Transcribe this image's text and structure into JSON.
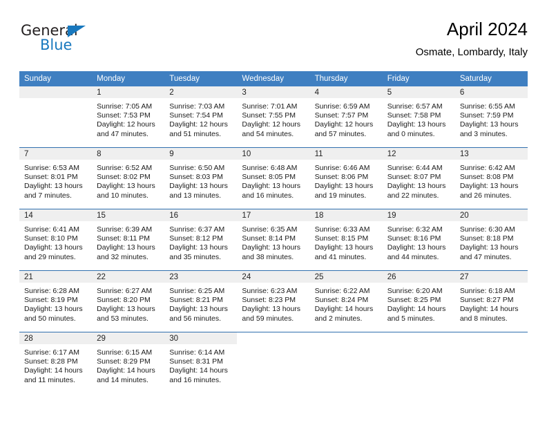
{
  "brand": {
    "name_top": "General",
    "name_bottom": "Blue",
    "triangle_color": "#1878be"
  },
  "header": {
    "title": "April 2024",
    "subtitle": "Osmate, Lombardy, Italy"
  },
  "theme": {
    "header_bar": "#3f7fc1",
    "row_divider": "#2f6fae",
    "daynum_band": "#efefef",
    "text": "#1a1a1a"
  },
  "weekday_headers": [
    "Sunday",
    "Monday",
    "Tuesday",
    "Wednesday",
    "Thursday",
    "Friday",
    "Saturday"
  ],
  "weeks": [
    [
      {
        "day": "",
        "lines": []
      },
      {
        "day": "1",
        "lines": [
          "Sunrise: 7:05 AM",
          "Sunset: 7:53 PM",
          "Daylight: 12 hours",
          "and 47 minutes."
        ]
      },
      {
        "day": "2",
        "lines": [
          "Sunrise: 7:03 AM",
          "Sunset: 7:54 PM",
          "Daylight: 12 hours",
          "and 51 minutes."
        ]
      },
      {
        "day": "3",
        "lines": [
          "Sunrise: 7:01 AM",
          "Sunset: 7:55 PM",
          "Daylight: 12 hours",
          "and 54 minutes."
        ]
      },
      {
        "day": "4",
        "lines": [
          "Sunrise: 6:59 AM",
          "Sunset: 7:57 PM",
          "Daylight: 12 hours",
          "and 57 minutes."
        ]
      },
      {
        "day": "5",
        "lines": [
          "Sunrise: 6:57 AM",
          "Sunset: 7:58 PM",
          "Daylight: 13 hours",
          "and 0 minutes."
        ]
      },
      {
        "day": "6",
        "lines": [
          "Sunrise: 6:55 AM",
          "Sunset: 7:59 PM",
          "Daylight: 13 hours",
          "and 3 minutes."
        ]
      }
    ],
    [
      {
        "day": "7",
        "lines": [
          "Sunrise: 6:53 AM",
          "Sunset: 8:01 PM",
          "Daylight: 13 hours",
          "and 7 minutes."
        ]
      },
      {
        "day": "8",
        "lines": [
          "Sunrise: 6:52 AM",
          "Sunset: 8:02 PM",
          "Daylight: 13 hours",
          "and 10 minutes."
        ]
      },
      {
        "day": "9",
        "lines": [
          "Sunrise: 6:50 AM",
          "Sunset: 8:03 PM",
          "Daylight: 13 hours",
          "and 13 minutes."
        ]
      },
      {
        "day": "10",
        "lines": [
          "Sunrise: 6:48 AM",
          "Sunset: 8:05 PM",
          "Daylight: 13 hours",
          "and 16 minutes."
        ]
      },
      {
        "day": "11",
        "lines": [
          "Sunrise: 6:46 AM",
          "Sunset: 8:06 PM",
          "Daylight: 13 hours",
          "and 19 minutes."
        ]
      },
      {
        "day": "12",
        "lines": [
          "Sunrise: 6:44 AM",
          "Sunset: 8:07 PM",
          "Daylight: 13 hours",
          "and 22 minutes."
        ]
      },
      {
        "day": "13",
        "lines": [
          "Sunrise: 6:42 AM",
          "Sunset: 8:08 PM",
          "Daylight: 13 hours",
          "and 26 minutes."
        ]
      }
    ],
    [
      {
        "day": "14",
        "lines": [
          "Sunrise: 6:41 AM",
          "Sunset: 8:10 PM",
          "Daylight: 13 hours",
          "and 29 minutes."
        ]
      },
      {
        "day": "15",
        "lines": [
          "Sunrise: 6:39 AM",
          "Sunset: 8:11 PM",
          "Daylight: 13 hours",
          "and 32 minutes."
        ]
      },
      {
        "day": "16",
        "lines": [
          "Sunrise: 6:37 AM",
          "Sunset: 8:12 PM",
          "Daylight: 13 hours",
          "and 35 minutes."
        ]
      },
      {
        "day": "17",
        "lines": [
          "Sunrise: 6:35 AM",
          "Sunset: 8:14 PM",
          "Daylight: 13 hours",
          "and 38 minutes."
        ]
      },
      {
        "day": "18",
        "lines": [
          "Sunrise: 6:33 AM",
          "Sunset: 8:15 PM",
          "Daylight: 13 hours",
          "and 41 minutes."
        ]
      },
      {
        "day": "19",
        "lines": [
          "Sunrise: 6:32 AM",
          "Sunset: 8:16 PM",
          "Daylight: 13 hours",
          "and 44 minutes."
        ]
      },
      {
        "day": "20",
        "lines": [
          "Sunrise: 6:30 AM",
          "Sunset: 8:18 PM",
          "Daylight: 13 hours",
          "and 47 minutes."
        ]
      }
    ],
    [
      {
        "day": "21",
        "lines": [
          "Sunrise: 6:28 AM",
          "Sunset: 8:19 PM",
          "Daylight: 13 hours",
          "and 50 minutes."
        ]
      },
      {
        "day": "22",
        "lines": [
          "Sunrise: 6:27 AM",
          "Sunset: 8:20 PM",
          "Daylight: 13 hours",
          "and 53 minutes."
        ]
      },
      {
        "day": "23",
        "lines": [
          "Sunrise: 6:25 AM",
          "Sunset: 8:21 PM",
          "Daylight: 13 hours",
          "and 56 minutes."
        ]
      },
      {
        "day": "24",
        "lines": [
          "Sunrise: 6:23 AM",
          "Sunset: 8:23 PM",
          "Daylight: 13 hours",
          "and 59 minutes."
        ]
      },
      {
        "day": "25",
        "lines": [
          "Sunrise: 6:22 AM",
          "Sunset: 8:24 PM",
          "Daylight: 14 hours",
          "and 2 minutes."
        ]
      },
      {
        "day": "26",
        "lines": [
          "Sunrise: 6:20 AM",
          "Sunset: 8:25 PM",
          "Daylight: 14 hours",
          "and 5 minutes."
        ]
      },
      {
        "day": "27",
        "lines": [
          "Sunrise: 6:18 AM",
          "Sunset: 8:27 PM",
          "Daylight: 14 hours",
          "and 8 minutes."
        ]
      }
    ],
    [
      {
        "day": "28",
        "lines": [
          "Sunrise: 6:17 AM",
          "Sunset: 8:28 PM",
          "Daylight: 14 hours",
          "and 11 minutes."
        ]
      },
      {
        "day": "29",
        "lines": [
          "Sunrise: 6:15 AM",
          "Sunset: 8:29 PM",
          "Daylight: 14 hours",
          "and 14 minutes."
        ]
      },
      {
        "day": "30",
        "lines": [
          "Sunrise: 6:14 AM",
          "Sunset: 8:31 PM",
          "Daylight: 14 hours",
          "and 16 minutes."
        ]
      },
      {
        "day": "",
        "lines": []
      },
      {
        "day": "",
        "lines": []
      },
      {
        "day": "",
        "lines": []
      },
      {
        "day": "",
        "lines": []
      }
    ]
  ]
}
